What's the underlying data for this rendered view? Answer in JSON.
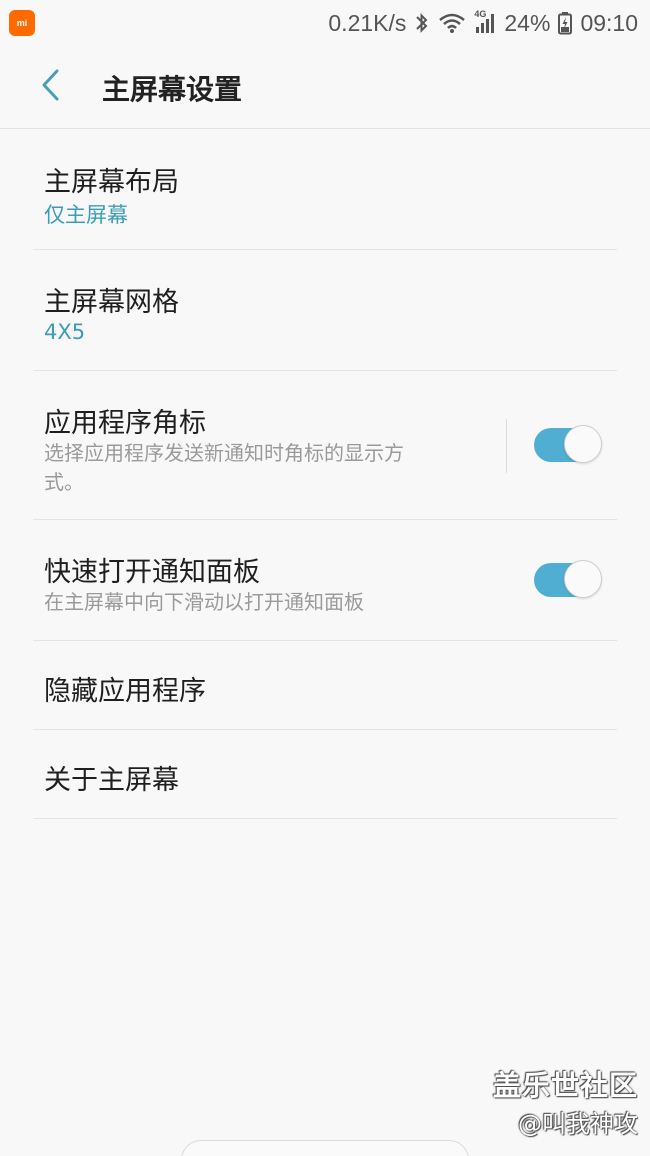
{
  "status_bar": {
    "app_icon_label": "mi",
    "net_speed": "0.21K/s",
    "network_type": "4G",
    "battery": "24%",
    "time": "09:10"
  },
  "header": {
    "title": "主屏幕设置"
  },
  "settings": [
    {
      "title": "主屏幕布局",
      "value": "仅主屏幕"
    },
    {
      "title": "主屏幕网格",
      "value": "4X5"
    },
    {
      "title": "应用程序角标",
      "description": "选择应用程序发送新通知时角标的显示方式。",
      "toggle_on": true
    },
    {
      "title": "快速打开通知面板",
      "description": "在主屏幕中向下滑动以打开通知面板",
      "toggle_on": true
    },
    {
      "title": "隐藏应用程序"
    },
    {
      "title": "关于主屏幕"
    }
  ],
  "watermark": {
    "site": "盖乐世社区",
    "author": "@叫我神攻"
  },
  "colors": {
    "accent": "#3c9db7",
    "toggle_on": "#4faed1",
    "app_icon": "#ff6a00"
  }
}
